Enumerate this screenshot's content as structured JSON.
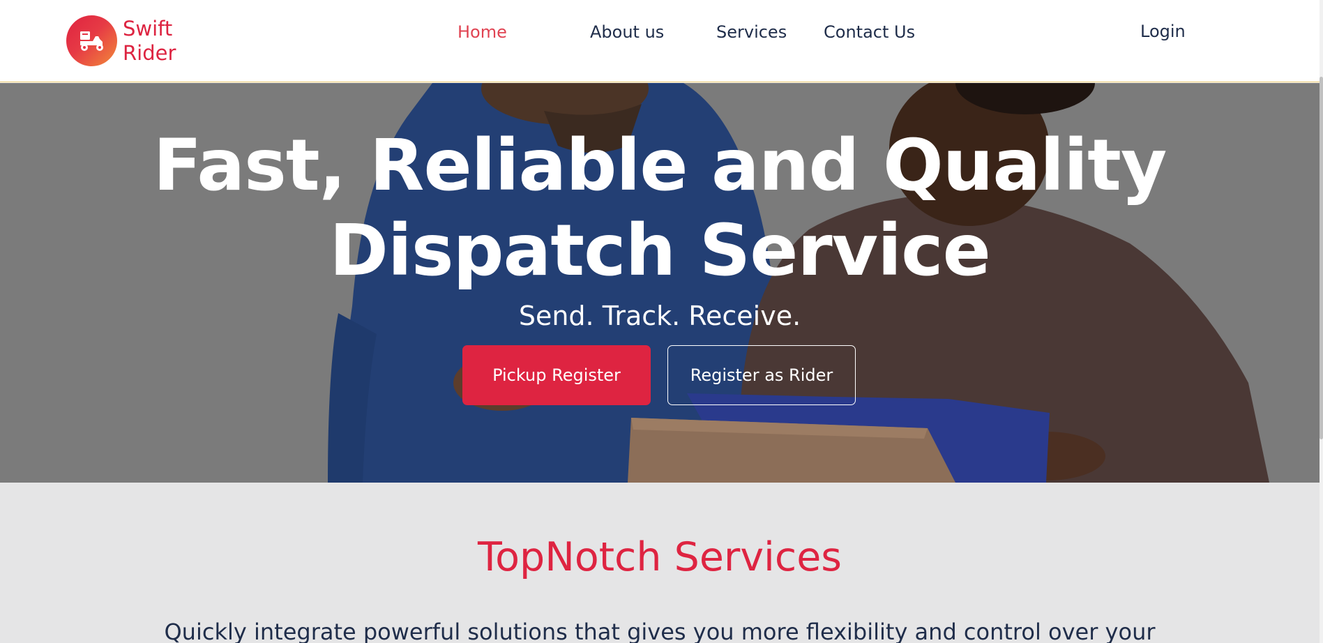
{
  "brand": {
    "name_line1": "Swift",
    "name_line2": "Rider",
    "logo_icon": "delivery-scooter-icon",
    "accent_color": "#de2441"
  },
  "nav": {
    "items": [
      {
        "label": "Home",
        "active": true
      },
      {
        "label": "About us",
        "active": false
      },
      {
        "label": "Services",
        "active": false
      },
      {
        "label": "Contact Us",
        "active": false
      }
    ],
    "login_label": "Login"
  },
  "hero": {
    "title_line1": "Fast, Reliable and Quality",
    "title_line2": "Dispatch Service",
    "subtitle": "Send. Track. Receive.",
    "primary_button": "Pickup Register",
    "secondary_button": "Register as Rider"
  },
  "services": {
    "title": "TopNotch Services",
    "description": "Quickly integrate powerful solutions that gives you more flexibility and control over your"
  }
}
